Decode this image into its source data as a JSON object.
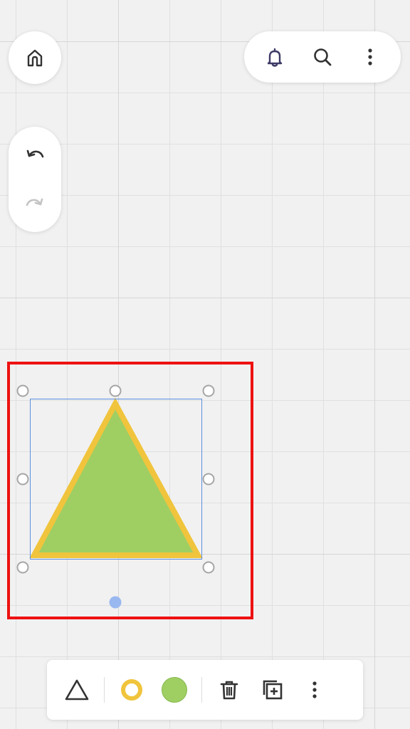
{
  "colors": {
    "canvas_bg": "#f1f1f1",
    "grid_line": "#e0e0e0",
    "selection_highlight": "#ee1111",
    "bounding_box": "#5b8fe0",
    "shape_fill": "#9fcf63",
    "shape_stroke": "#f0c43c",
    "rotate_handle": "#9ab8f0",
    "icon_dark": "#333333",
    "icon_disabled": "#c4c4c4",
    "bell_accent": "#3d3a66"
  },
  "top_left": {
    "home_icon": "home-icon"
  },
  "top_right": {
    "icons": [
      "bell-icon",
      "search-icon",
      "more-vertical-icon"
    ]
  },
  "history": {
    "undo_icon": "undo-icon",
    "redo_icon": "redo-icon",
    "redo_enabled": false
  },
  "shape": {
    "type": "triangle",
    "fill": "#9fcf63",
    "stroke": "#f0c43c",
    "selected": true
  },
  "toolbar": {
    "items": [
      {
        "icon": "triangle-outline-icon",
        "role": "shape type"
      },
      {
        "icon": "stroke-color-swatch",
        "color": "#f0c43c"
      },
      {
        "icon": "fill-color-swatch",
        "color": "#9fcf63"
      },
      {
        "icon": "trash-icon",
        "role": "delete"
      },
      {
        "icon": "duplicate-icon",
        "role": "duplicate"
      },
      {
        "icon": "more-vertical-icon",
        "role": "more"
      }
    ]
  }
}
